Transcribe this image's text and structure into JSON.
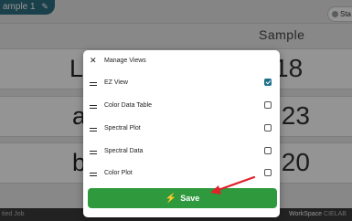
{
  "topbar": {
    "sample_tab": "ample 1",
    "edit_icon": "pencil-icon",
    "status_chip": "Sta"
  },
  "table": {
    "column_header": "Sample",
    "rows": [
      {
        "label": "L",
        "value": "18"
      },
      {
        "label": "a",
        "value": ".23"
      },
      {
        "label": "b",
        "value": ".20"
      }
    ]
  },
  "bottombar": {
    "left_text": "tied Job",
    "workspace_label": "WorkSpace",
    "workspace_value": "CIELAB"
  },
  "modal": {
    "title": "Manage Views",
    "close_icon": "close-icon",
    "items": [
      {
        "label": "EZ View",
        "checked": true
      },
      {
        "label": "Color Data Table",
        "checked": false
      },
      {
        "label": "Spectral Plot",
        "checked": false
      },
      {
        "label": "Spectral Data",
        "checked": false
      },
      {
        "label": "Color Plot",
        "checked": false
      }
    ],
    "save_label": "Save",
    "save_icon": "lightning-icon"
  },
  "colors": {
    "tab": "#2d6f82",
    "save": "#2f9a3d",
    "checkbox": "#1f6f8b",
    "arrow": "#e0222b"
  }
}
